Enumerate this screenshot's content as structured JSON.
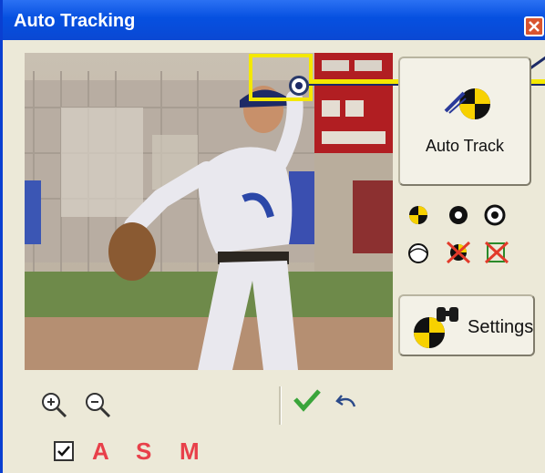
{
  "window": {
    "title": "Auto Tracking",
    "close_icon": "close-icon",
    "accent_color": "#0650e0"
  },
  "video": {
    "description_icon": "video-frame",
    "tracker_color": "#f4e800"
  },
  "buttons": {
    "auto_track_label": "Auto Track",
    "settings_label": "Settings"
  },
  "mode_icons": [
    "yellow-tracker-icon",
    "ring-icon",
    "target-icon",
    "outline-circle-icon",
    "delete-tracker-icon",
    "delete-all-trackers-icon"
  ],
  "bottom_toolbar": {
    "icons": [
      "zoom-in-icon",
      "zoom-out-icon",
      "accept-checkmark-icon",
      "undo-icon"
    ],
    "checkbox_checked": true,
    "letters": [
      "A",
      "S",
      "M"
    ],
    "letter_color": "#e8404a"
  }
}
